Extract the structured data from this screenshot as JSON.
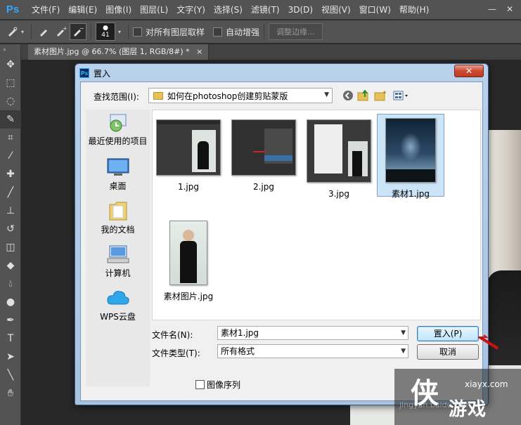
{
  "app": {
    "logo": "Ps",
    "menu": [
      "文件(F)",
      "编辑(E)",
      "图像(I)",
      "图层(L)",
      "文字(Y)",
      "选择(S)",
      "滤镜(T)",
      "3D(D)",
      "视图(V)",
      "窗口(W)",
      "帮助(H)"
    ],
    "window_controls": {
      "minimize": "—",
      "close": "✕"
    }
  },
  "options_bar": {
    "brush_size": "41",
    "sample_all_layers": "对所有图层取样",
    "auto_enhance": "自动增强",
    "refine_edge": "调整边缘..."
  },
  "document_tab": {
    "label": "素材图片.jpg @ 66.7% (图层 1, RGB/8#) *",
    "close": "×"
  },
  "dialog": {
    "title": "置入",
    "title_icon": "Ps",
    "look_in_label": "查找范围(I):",
    "look_in_value": "如何在photoshop创建剪贴蒙版",
    "places": [
      {
        "label": "最近使用的项目",
        "icon": "recent-icon"
      },
      {
        "label": "桌面",
        "icon": "desktop-icon"
      },
      {
        "label": "我的文档",
        "icon": "documents-icon"
      },
      {
        "label": "计算机",
        "icon": "computer-icon"
      },
      {
        "label": "WPS云盘",
        "icon": "cloud-icon"
      }
    ],
    "files": [
      {
        "name": "1.jpg",
        "selected": false
      },
      {
        "name": "2.jpg",
        "selected": false
      },
      {
        "name": "3.jpg",
        "selected": false
      },
      {
        "name": "素材1.jpg",
        "selected": true
      },
      {
        "name": "素材图片.jpg",
        "selected": false
      }
    ],
    "filename_label": "文件名(N):",
    "filename_value": "素材1.jpg",
    "filetype_label": "文件类型(T):",
    "filetype_value": "所有格式",
    "place_button": "置入(P)",
    "cancel_button": "取消",
    "image_sequence": "图像序列"
  },
  "watermark": {
    "big": "侠",
    "small": "xiayx.com",
    "cn": "游戏",
    "url": "jingyan.baidu.com"
  },
  "colors": {
    "ps_blue": "#31a8ff",
    "dialog_frame": "#b9d1ea",
    "selection": "#cce4f7",
    "arrow": "#cc1111"
  }
}
